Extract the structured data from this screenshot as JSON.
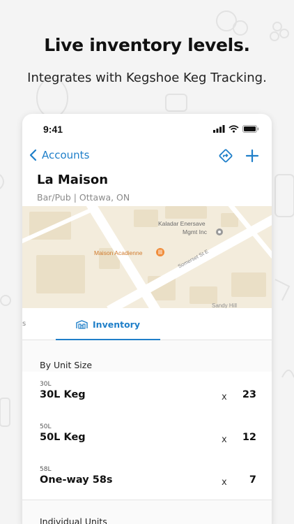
{
  "headline": "Live inventory levels.",
  "subline": "Integrates with Kegshoe Keg Tracking.",
  "status_bar": {
    "time": "9:41"
  },
  "nav": {
    "back_label": "Accounts"
  },
  "account": {
    "name": "La Maison",
    "subtitle": "Bar/Pub | Ottawa, ON"
  },
  "map": {
    "labels": {
      "business1_line1": "Kaladar Enersave",
      "business1_line2": "Mgmt Inc",
      "business2": "Maison Acadienne",
      "street": "Somerset St E",
      "street2": "Sandy Hill"
    }
  },
  "tabs": {
    "partial": "s",
    "inventory": "Inventory"
  },
  "inventory": {
    "by_unit_title": "By Unit Size",
    "items": [
      {
        "code": "30L",
        "name": "30L Keg",
        "mult": "x",
        "qty": "23"
      },
      {
        "code": "50L",
        "name": "50L Keg",
        "mult": "x",
        "qty": "12"
      },
      {
        "code": "58L",
        "name": "One-way 58s",
        "mult": "x",
        "qty": "7"
      }
    ],
    "individual_title": "Individual Units"
  },
  "colors": {
    "accent": "#1f7fc9",
    "map_bg": "#f3ecdc",
    "poi": "#f08c3a"
  }
}
